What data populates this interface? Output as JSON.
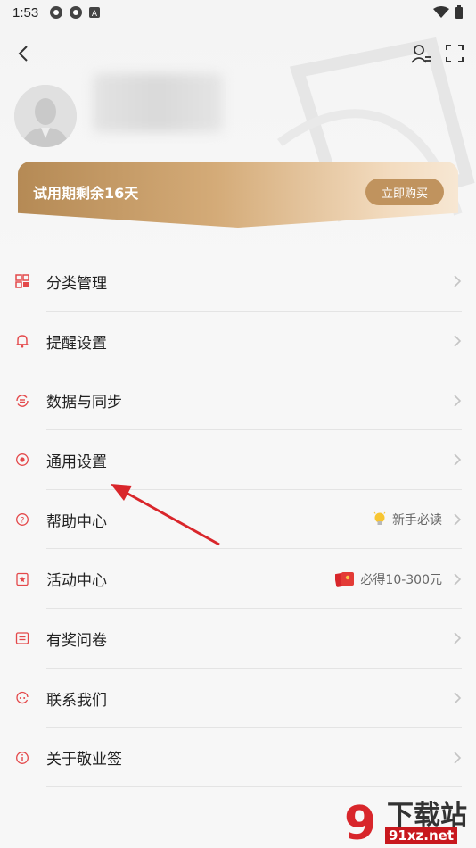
{
  "status_bar": {
    "time": "1:53"
  },
  "trial": {
    "text": "试用期剩余16天",
    "button": "立即购买"
  },
  "menu": [
    {
      "label": "分类管理",
      "icon": "grid-icon"
    },
    {
      "label": "提醒设置",
      "icon": "bell-icon"
    },
    {
      "label": "数据与同步",
      "icon": "sync-icon"
    },
    {
      "label": "通用设置",
      "icon": "general-settings-icon"
    },
    {
      "label": "帮助中心",
      "icon": "help-icon",
      "extra": "新手必读",
      "extra_icon": "lightbulb-icon"
    },
    {
      "label": "活动中心",
      "icon": "activity-icon",
      "extra": "必得10-300元",
      "extra_icon": "red-envelope-icon"
    },
    {
      "label": "有奖问卷",
      "icon": "survey-icon"
    },
    {
      "label": "联系我们",
      "icon": "contact-icon"
    },
    {
      "label": "关于敬业签",
      "icon": "info-icon"
    }
  ],
  "watermark": {
    "title": "下载站",
    "site": "91xz.net"
  },
  "colors": {
    "accent": "#e4484a",
    "gold": "#c0935e"
  }
}
